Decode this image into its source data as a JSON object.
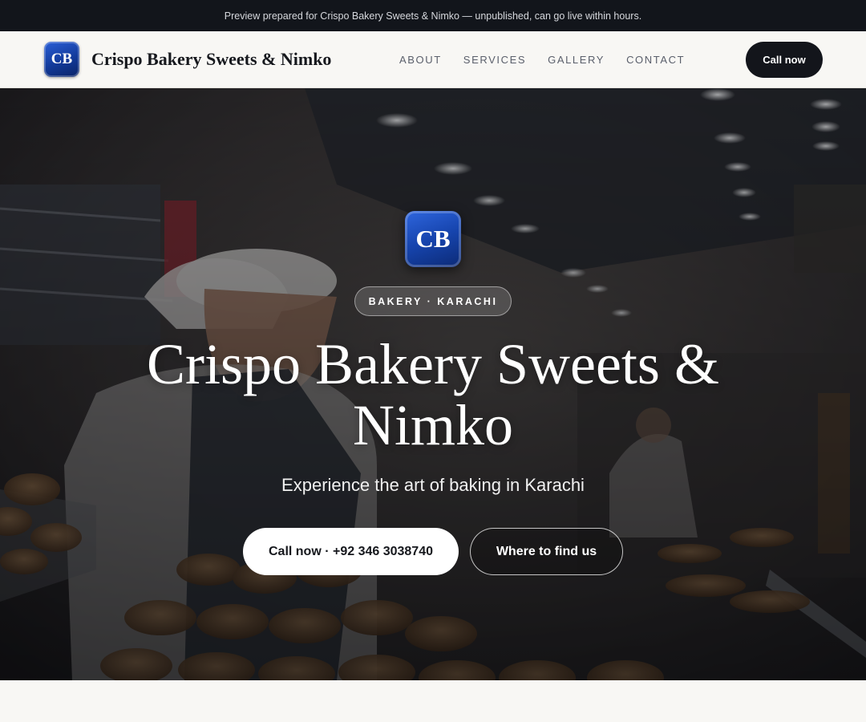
{
  "topbar": {
    "text": "Preview prepared for Crispo Bakery Sweets & Nimko — unpublished, can go live within hours."
  },
  "navbar": {
    "logo_text": "CB",
    "brand_name": "Crispo Bakery Sweets & Nimko",
    "links": [
      {
        "label": "ABOUT"
      },
      {
        "label": "SERVICES"
      },
      {
        "label": "GALLERY"
      },
      {
        "label": "CONTACT"
      }
    ],
    "cta_label": "Call now"
  },
  "hero": {
    "logo_text": "CB",
    "badge": "BAKERY · KARACHI",
    "title": "Crispo Bakery Sweets & Nimko",
    "subtitle": "Experience the art of baking in Karachi",
    "primary_button": "Call now · +92 346 3038740",
    "secondary_button": "Where to find us"
  },
  "colors": {
    "topbar_bg": "#12151b",
    "nav_bg": "#f8f7f4",
    "accent_dark": "#13151b",
    "logo_blue": "#1644ad"
  }
}
